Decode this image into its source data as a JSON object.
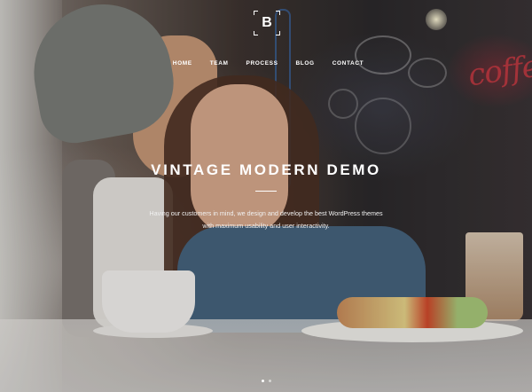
{
  "brand": {
    "logo_letter": "B"
  },
  "nav": {
    "items": [
      "HOME",
      "TEAM",
      "PROCESS",
      "BLOG",
      "CONTACT"
    ]
  },
  "hero": {
    "title": "VINTAGE MODERN DEMO",
    "description_line1": "Having our customers in mind, we design and develop the best WordPress themes",
    "description_line2": "with maximum usability and user interactivity.",
    "sign_text": "coffe"
  },
  "slider": {
    "slide_count": 2,
    "active_index": 0
  },
  "colors": {
    "text": "#ffffff",
    "overlay": "#2a2522"
  }
}
